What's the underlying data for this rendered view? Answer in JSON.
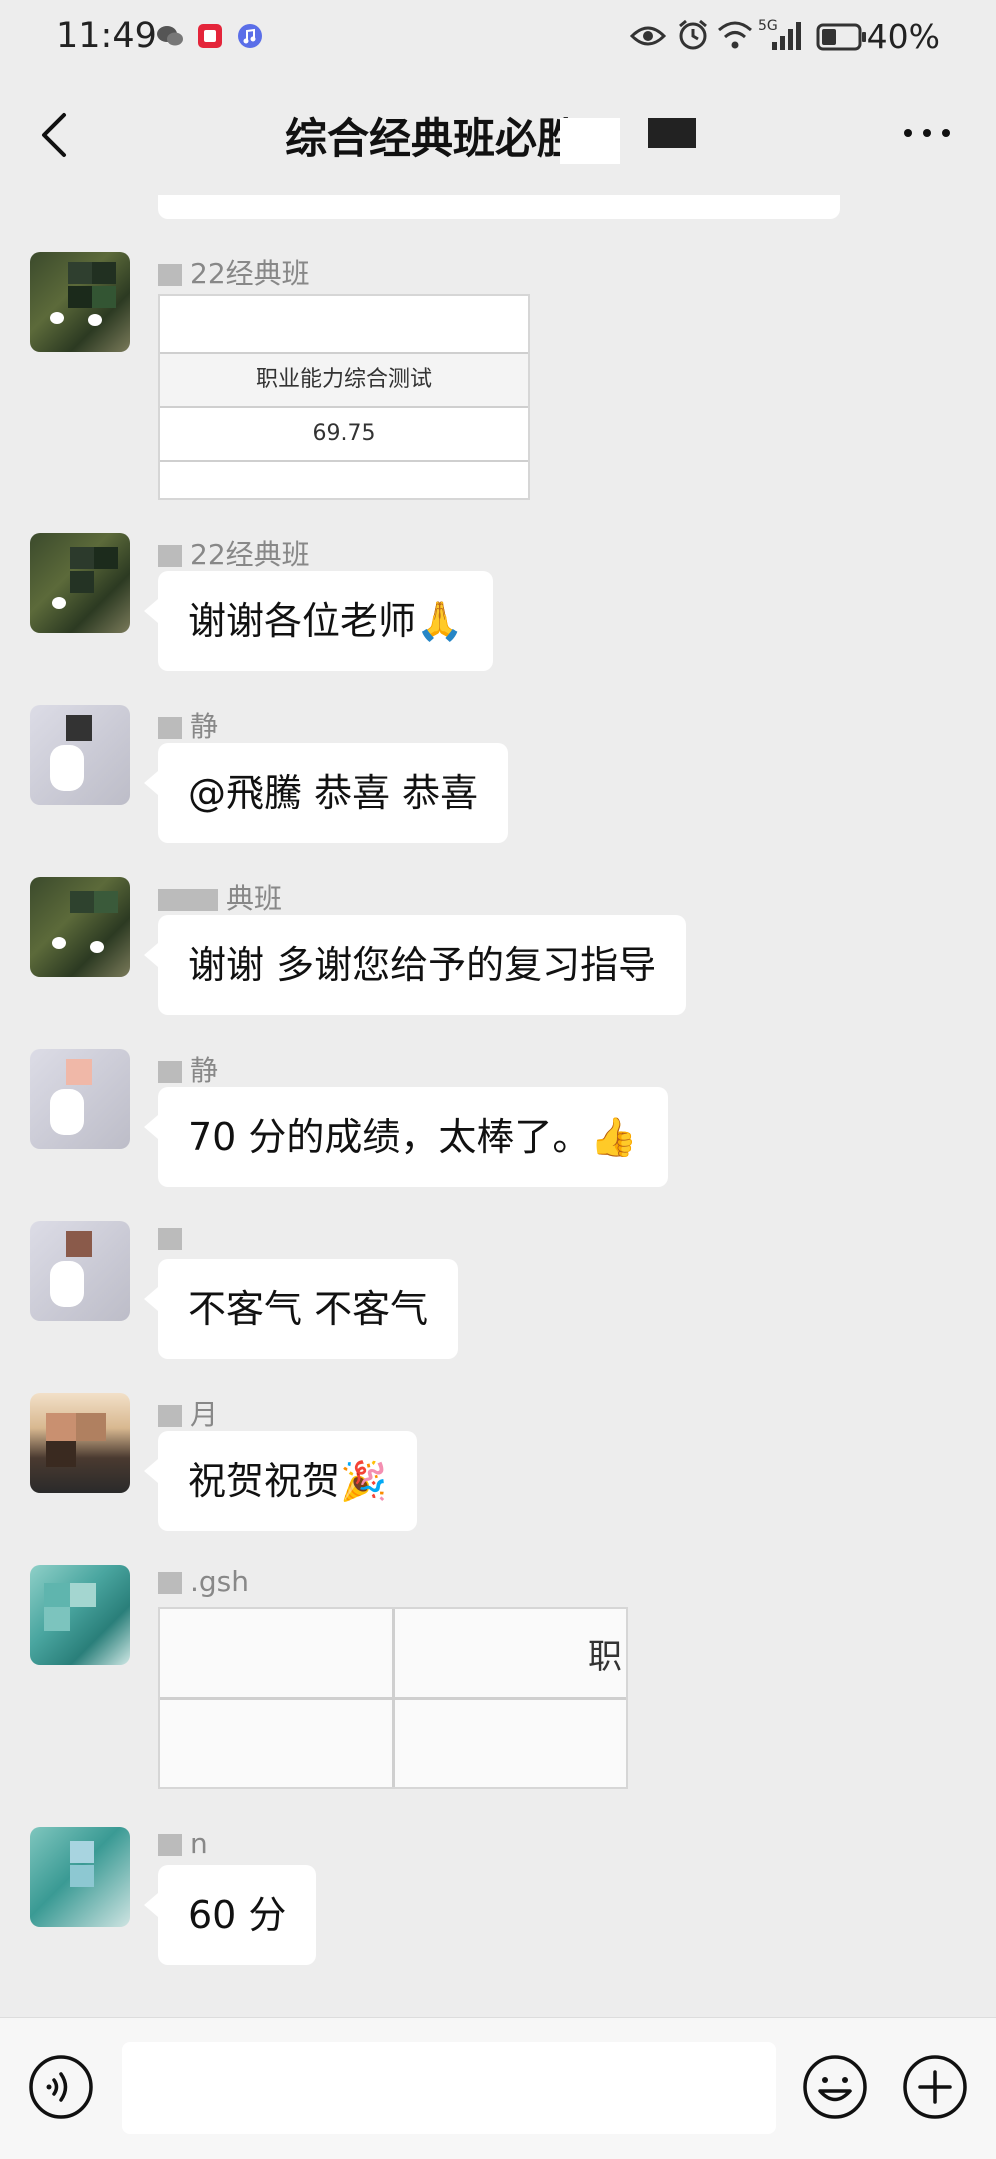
{
  "status_bar": {
    "time": "11:49",
    "battery": "40%",
    "network": "5G",
    "icons": [
      "wechat-icon",
      "app-icon",
      "music-icon",
      "eye-icon",
      "alarm-icon",
      "wifi-icon",
      "signal-icon",
      "battery-icon"
    ]
  },
  "nav": {
    "title": "综合经典班必胜",
    "back_icon": "chevron-left-icon",
    "more_icon": "more-icon"
  },
  "messages": [
    {
      "sender": "22经典班",
      "type": "image-table",
      "table_header": "职业能力综合测试",
      "table_value": "69.75"
    },
    {
      "sender": "22经典班",
      "type": "text",
      "text": "谢谢各位老师🙏"
    },
    {
      "sender": "静",
      "type": "text",
      "text": "@飛騰  恭喜 恭喜"
    },
    {
      "sender": "典班",
      "type": "text",
      "text": "谢谢 多谢您给予的复习指导"
    },
    {
      "sender": "静",
      "type": "text",
      "text": "70 分的成绩，太棒了。👍"
    },
    {
      "sender": "",
      "type": "text",
      "text": "不客气  不客气"
    },
    {
      "sender": "月",
      "type": "text",
      "text": "祝贺祝贺🎉"
    },
    {
      "sender": ".gsh",
      "type": "image-table",
      "table_header": "职",
      "table_value": ""
    },
    {
      "sender": "n",
      "type": "text",
      "text": "60 分"
    }
  ],
  "input_bar": {
    "voice_icon": "voice-icon",
    "emoji_icon": "emoji-icon",
    "plus_icon": "plus-icon"
  },
  "colors": {
    "background": "#ededed",
    "bubble": "#ffffff",
    "input_bar": "#f7f7f7"
  }
}
